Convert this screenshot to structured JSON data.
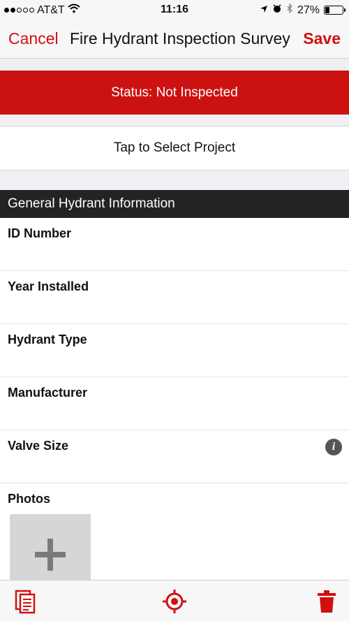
{
  "status_bar": {
    "carrier": "AT&T",
    "time": "11:16",
    "battery": "27%",
    "battery_level": 0.27
  },
  "nav": {
    "cancel_label": "Cancel",
    "title": "Fire Hydrant Inspection Survey",
    "save_label": "Save"
  },
  "status_banner": {
    "text": "Status: Not Inspected"
  },
  "project": {
    "label": "Tap to Select Project"
  },
  "section": {
    "title": "General Hydrant Information",
    "fields": [
      {
        "label": "ID Number"
      },
      {
        "label": "Year Installed"
      },
      {
        "label": "Hydrant Type"
      },
      {
        "label": "Manufacturer"
      },
      {
        "label": "Valve Size",
        "info_icon": "info-icon"
      },
      {
        "label": "Photos"
      }
    ]
  },
  "toolbar": {
    "icons": [
      "copy-form-icon",
      "locate-icon",
      "trash-icon"
    ]
  },
  "colors": {
    "accent": "#cc1111",
    "header_bg": "#232323"
  }
}
